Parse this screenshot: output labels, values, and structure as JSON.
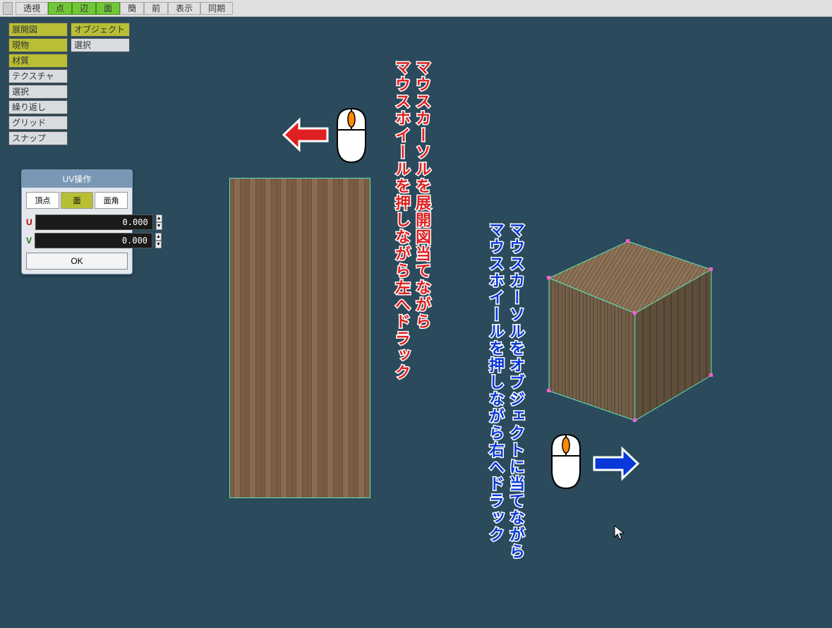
{
  "toolbar": {
    "buttons": [
      {
        "label": "透視",
        "active": false
      },
      {
        "label": "点",
        "active": true
      },
      {
        "label": "辺",
        "active": true
      },
      {
        "label": "面",
        "active": true
      },
      {
        "label": "簡",
        "active": false
      },
      {
        "label": "前",
        "active": false
      },
      {
        "label": "表示",
        "active": false
      },
      {
        "label": "同期",
        "active": false
      }
    ]
  },
  "sidebar": {
    "rows": [
      [
        {
          "label": "展開図",
          "yellow": true
        },
        {
          "label": "オブジェクト",
          "yellow": true,
          "wide": true
        }
      ],
      [
        {
          "label": "現物",
          "yellow": true
        },
        {
          "label": "選択",
          "yellow": false,
          "wide": true
        }
      ]
    ],
    "items": [
      {
        "label": "材質",
        "yellow": true
      },
      {
        "label": "テクスチャ",
        "yellow": false
      },
      {
        "label": "選択",
        "yellow": false
      },
      {
        "label": "繰り返し",
        "yellow": false
      },
      {
        "label": "グリッド",
        "yellow": false
      },
      {
        "label": "スナップ",
        "yellow": false
      }
    ]
  },
  "uvPanel": {
    "title": "UV操作",
    "tabs": [
      {
        "label": "頂点",
        "active": false
      },
      {
        "label": "面",
        "active": true
      },
      {
        "label": "面角",
        "active": false
      }
    ],
    "u_label": "U",
    "v_label": "V",
    "u_value": "0.000",
    "v_value": "0.000",
    "ok_label": "OK"
  },
  "annotations": {
    "left_line1": "マウスカーソルを展開図当てながら",
    "left_line2": "マウスホイールを押しながら左へドラック",
    "right_line1": "マウスカーソルをオブジェクトに当てながら",
    "right_line2": "マウスホイールを押しながら右へドラック"
  }
}
